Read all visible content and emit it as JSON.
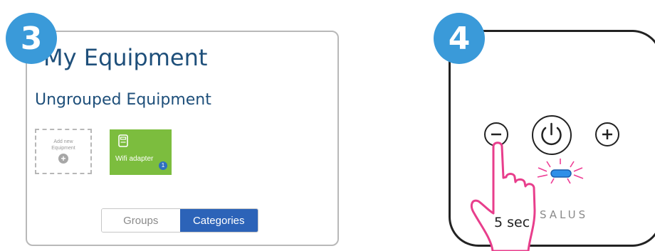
{
  "steps": {
    "left": "3",
    "right": "4"
  },
  "equipment_panel": {
    "title": "My Equipment",
    "subtitle": "Ungrouped Equipment",
    "add_tile": {
      "label": "Add new Equipment",
      "icon": "plus-icon"
    },
    "device_tile": {
      "label": "Wifi adapter",
      "count": "1",
      "color": "#7cbd3e",
      "icon": "device-icon"
    },
    "toggle": {
      "groups": "Groups",
      "categories": "Categories",
      "selected": "Categories",
      "accent": "#2c63b8"
    }
  },
  "device_panel": {
    "buttons": [
      "minus-icon",
      "power-icon",
      "plus-icon"
    ],
    "brand": "SALUS",
    "led_color": "#2f8fe8",
    "led_glow": "#ee3d95",
    "instruction": "5 sec",
    "hand_color": "#e83e8c"
  }
}
